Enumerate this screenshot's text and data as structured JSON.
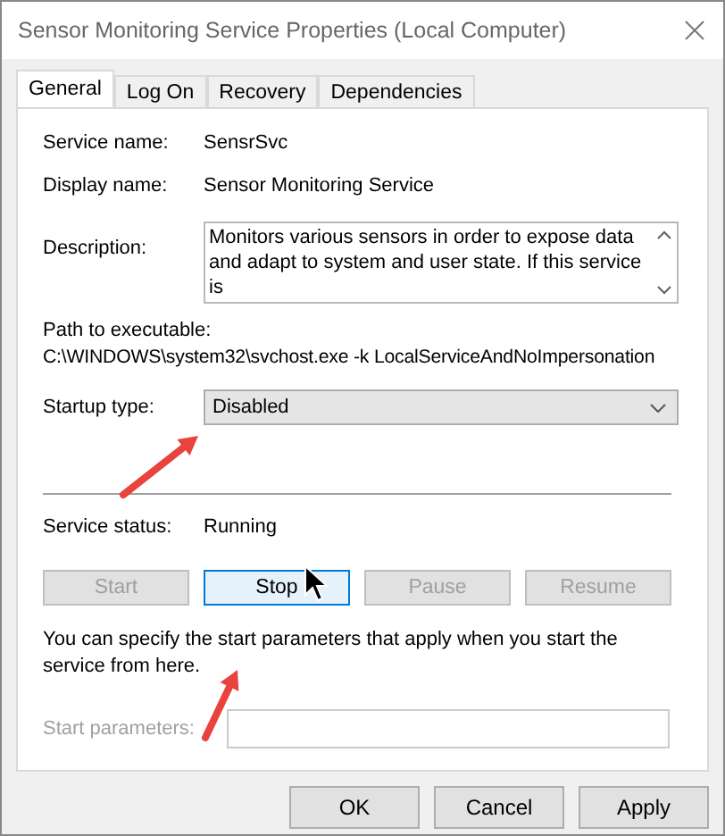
{
  "window": {
    "title": "Sensor Monitoring Service Properties (Local Computer)"
  },
  "tabs": [
    {
      "label": "General",
      "selected": true
    },
    {
      "label": "Log On",
      "selected": false
    },
    {
      "label": "Recovery",
      "selected": false
    },
    {
      "label": "Dependencies",
      "selected": false
    }
  ],
  "service_name": {
    "label": "Service name:",
    "value": "SensrSvc"
  },
  "display_name": {
    "label": "Display name:",
    "value": "Sensor Monitoring Service"
  },
  "description": {
    "label": "Description:",
    "value": "Monitors various sensors in order to expose data and adapt to system and user state.  If this service is"
  },
  "path": {
    "label": "Path to executable:",
    "value": "C:\\WINDOWS\\system32\\svchost.exe -k LocalServiceAndNoImpersonation"
  },
  "startup_type": {
    "label": "Startup type:",
    "value": "Disabled"
  },
  "service_status": {
    "label": "Service status:",
    "value": "Running"
  },
  "service_buttons": [
    {
      "label": "Start",
      "disabled": true,
      "hovered": false
    },
    {
      "label": "Stop",
      "disabled": false,
      "hovered": true
    },
    {
      "label": "Pause",
      "disabled": true,
      "hovered": false
    },
    {
      "label": "Resume",
      "disabled": true,
      "hovered": false
    }
  ],
  "help_text": "You can specify the start parameters that apply when you start the service from here.",
  "start_parameters": {
    "label": "Start parameters:",
    "disabled": true
  },
  "dialog_buttons": [
    {
      "label": "OK"
    },
    {
      "label": "Cancel"
    },
    {
      "label": "Apply"
    }
  ]
}
